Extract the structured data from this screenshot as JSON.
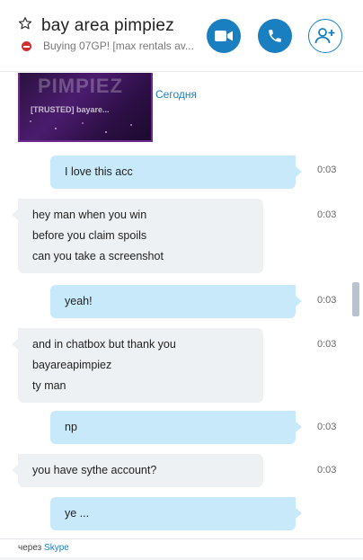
{
  "header": {
    "title": "bay area pimpiez",
    "mood": "Buying 07GP! [max rentals av...",
    "video_button": "video-call",
    "call_button": "voice-call",
    "add_button": "add-contact"
  },
  "shared_image": {
    "ghost_text": "PIMPIEZ",
    "caption": "[TRUSTED] bayare..."
  },
  "day_label": "Сегодня",
  "messages": [
    {
      "dir": "out",
      "lines": [
        "I love this acc"
      ],
      "time": "0:03"
    },
    {
      "dir": "in",
      "lines": [
        "hey man when you win",
        "before you claim spoils",
        "can you take a screenshot"
      ],
      "time": "0:03"
    },
    {
      "dir": "out",
      "lines": [
        "yeah!"
      ],
      "time": "0:03"
    },
    {
      "dir": "in",
      "lines": [
        "and in chatbox but thank you",
        "bayareapimpiez",
        "ty man"
      ],
      "time": "0:03"
    },
    {
      "dir": "out",
      "lines": [
        "np"
      ],
      "time": "0:03"
    },
    {
      "dir": "in",
      "lines": [
        "you have sythe account?"
      ],
      "time": "0:03"
    },
    {
      "dir": "out",
      "lines": [
        "ye ..."
      ],
      "time": ""
    }
  ],
  "footer": {
    "via_prefix": "через",
    "via_link": "Skype"
  },
  "colors": {
    "accent": "#1a7fc1",
    "out_bubble": "#c7e9fa",
    "in_bubble": "#eef1f4",
    "status_busy": "#d32f2f"
  }
}
